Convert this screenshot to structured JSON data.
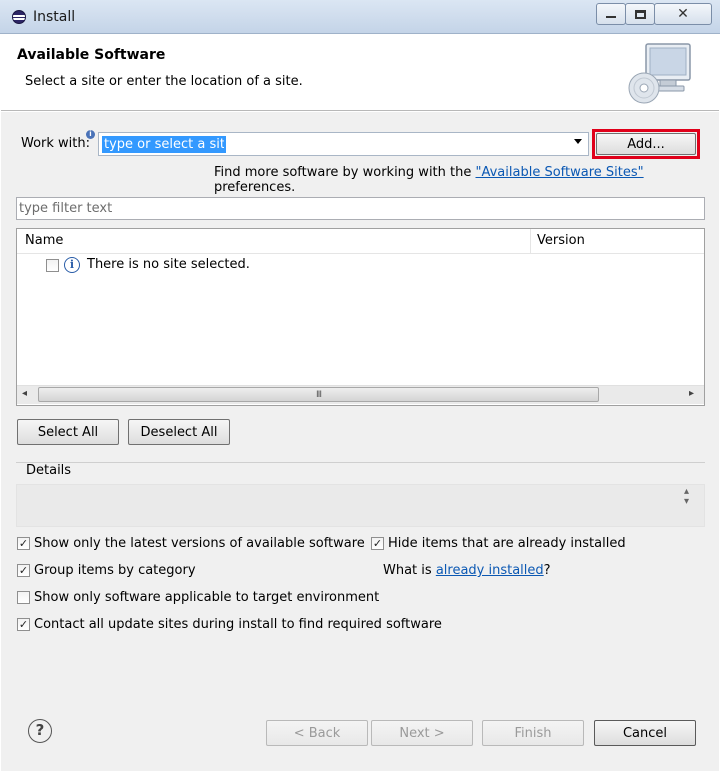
{
  "window": {
    "title": "Install",
    "controls": {
      "minimize": "minimize",
      "maximize": "maximize",
      "close": "✕"
    }
  },
  "header": {
    "title": "Available Software",
    "subtitle": "Select a site or enter the location of a site.",
    "icon": "monitor-cd-icon"
  },
  "work_with": {
    "label": "Work with:",
    "value": "type or select a site",
    "add_button": "Add...",
    "find_more_prefix": "Find more software by working with the ",
    "find_more_link": "\"Available Software Sites\"",
    "find_more_suffix": " preferences."
  },
  "filter": {
    "placeholder": "type filter text"
  },
  "table": {
    "columns": [
      "Name",
      "Version"
    ],
    "rows": [
      {
        "checked": false,
        "icon": "info-icon",
        "text": "There is no site selected."
      }
    ],
    "scroll_grip": "III"
  },
  "selection_buttons": {
    "select_all": "Select All",
    "deselect_all": "Deselect All"
  },
  "details": {
    "label": "Details"
  },
  "options": {
    "latest_versions": {
      "label": "Show only the latest versions of available software",
      "checked": true
    },
    "group_by_category": {
      "label": "Group items by category",
      "checked": true
    },
    "target_environment": {
      "label": "Show only software applicable to target environment",
      "checked": false
    },
    "contact_update_sites": {
      "label": "Contact all update sites during install to find required software",
      "checked": true
    },
    "hide_installed": {
      "label": "Hide items that are already installed",
      "checked": true
    },
    "what_is_prefix": "What is ",
    "what_is_link": "already installed",
    "what_is_suffix": "?"
  },
  "footer": {
    "help": "?",
    "back": "< Back",
    "next": "Next >",
    "finish": "Finish",
    "cancel": "Cancel"
  },
  "colors": {
    "highlight_box": "#e0001a",
    "link": "#0b58b3",
    "selection": "#3399ff"
  }
}
